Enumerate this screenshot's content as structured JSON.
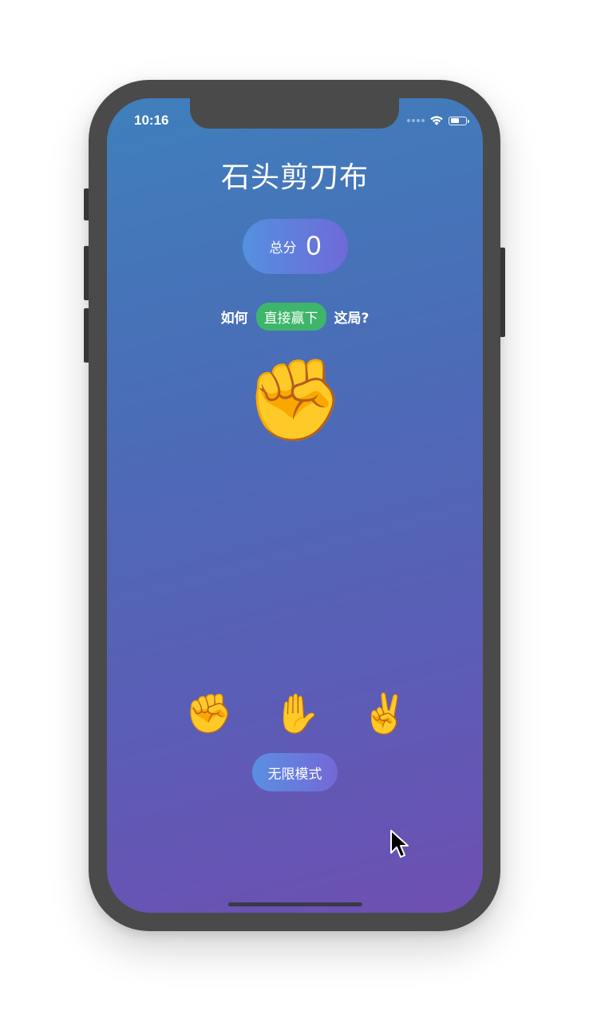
{
  "status_bar": {
    "time": "10:16",
    "battery_level": 0.6
  },
  "game": {
    "title": "石头剪刀布",
    "score_label": "总分",
    "score_value": "0",
    "prompt_prefix": "如何",
    "prompt_tag": "直接赢下",
    "prompt_suffix": "这局?",
    "current_hand": "✊",
    "choices": [
      {
        "name": "rock",
        "glyph": "✊"
      },
      {
        "name": "paper",
        "glyph": "✋"
      },
      {
        "name": "scissors",
        "glyph": "✌️"
      }
    ],
    "mode_button": "无限模式"
  },
  "colors": {
    "screen_top": "#3f7fbc",
    "screen_bottom": "#6e4fb2",
    "tag_green": "#3db56a",
    "phone_frame": "#4a4a4a"
  },
  "icons": [
    "wifi-icon",
    "battery-icon",
    "cursor-icon"
  ]
}
